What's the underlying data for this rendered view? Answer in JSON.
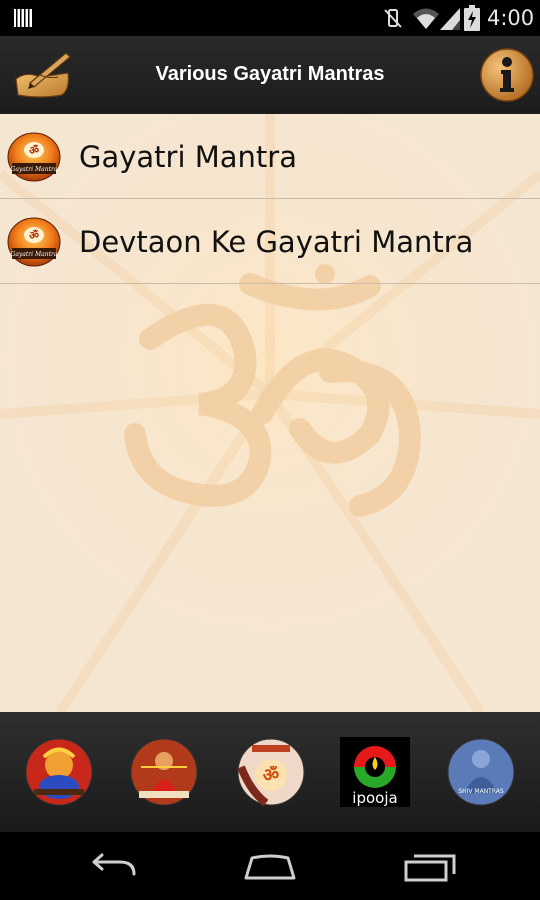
{
  "status_bar": {
    "time": "4:00"
  },
  "action_bar": {
    "title": "Various Gayatri Mantras"
  },
  "list": {
    "items": [
      {
        "label": "Gayatri Mantra",
        "icon_caption": "Gayatri Mantra"
      },
      {
        "label": "Devtaon Ke Gayatri Mantra",
        "icon_caption": "Gayatri Mantra"
      }
    ]
  },
  "app_strip": {
    "apps": [
      {
        "name": "ganesh-app"
      },
      {
        "name": "durga-app"
      },
      {
        "name": "laxmi-app"
      },
      {
        "name": "ipooja-app",
        "logo_text": "ipooja"
      },
      {
        "name": "shiv-mantras-app",
        "logo_text": "SHIV MANTRAS"
      }
    ]
  },
  "colors": {
    "content_bg": "#f5e6d2",
    "action_bar": "#222222",
    "accent_orange": "#e8741c"
  }
}
